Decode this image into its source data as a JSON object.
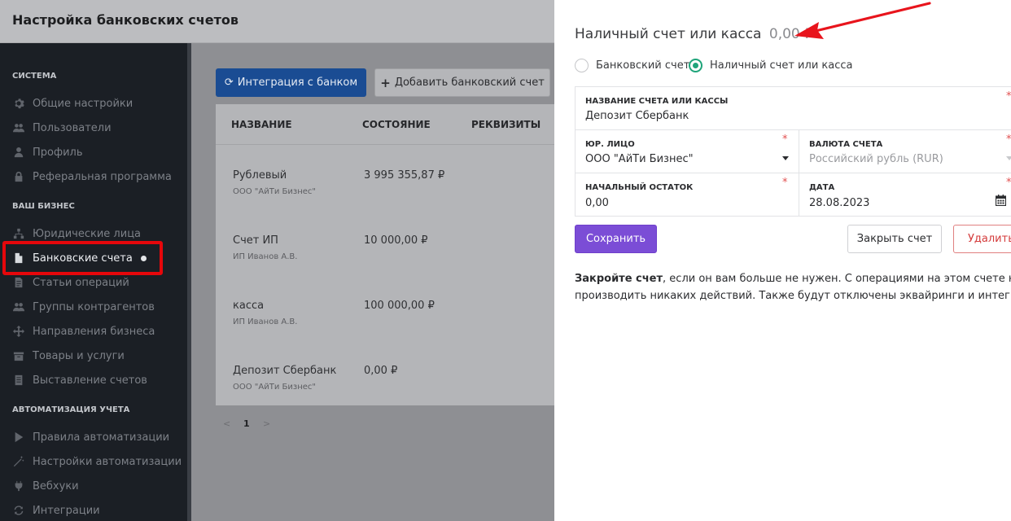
{
  "app": {
    "title": "Настройка банковских счетов"
  },
  "sidebar": {
    "sections": [
      {
        "label": "СИСТЕМА",
        "items": [
          {
            "label": "Общие настройки",
            "icon": "gear-icon"
          },
          {
            "label": "Пользователи",
            "icon": "users-icon"
          },
          {
            "label": "Профиль",
            "icon": "user-icon"
          },
          {
            "label": "Реферальная программа",
            "icon": "lock-icon"
          }
        ]
      },
      {
        "label": "ВАШ БИЗНЕС",
        "items": [
          {
            "label": "Юридические лица",
            "icon": "sitemap-icon"
          },
          {
            "label": "Банковские счета",
            "icon": "file-icon",
            "active": true
          },
          {
            "label": "Статьи операций",
            "icon": "document-icon"
          },
          {
            "label": "Группы контрагентов",
            "icon": "users-icon"
          },
          {
            "label": "Направления бизнеса",
            "icon": "arrows-icon"
          },
          {
            "label": "Товары и услуги",
            "icon": "box-icon"
          },
          {
            "label": "Выставление счетов",
            "icon": "invoice-icon"
          }
        ]
      },
      {
        "label": "АВТОМАТИЗАЦИЯ УЧЕТА",
        "items": [
          {
            "label": "Правила автоматизации",
            "icon": "play-icon"
          },
          {
            "label": "Настройки автоматизации",
            "icon": "magic-wand-icon"
          },
          {
            "label": "Вебхуки",
            "icon": "plug-icon"
          },
          {
            "label": "Интеграции",
            "icon": "refresh-icon"
          }
        ]
      }
    ]
  },
  "toolbar": {
    "integration_label": "Интеграция с банком",
    "integration_icon": "refresh-icon",
    "add_label": "Добавить банковский счет",
    "add_icon": "plus-icon"
  },
  "table": {
    "columns": [
      "НАЗВАНИЕ",
      "СОСТОЯНИЕ",
      "РЕКВИЗИТЫ"
    ],
    "rows": [
      {
        "name": "Рублевый",
        "owner": "ООО \"АйТи Бизнес\"",
        "state": "3 995 355,87 ₽"
      },
      {
        "name": "Счет ИП",
        "owner": "ИП Иванов А.В.",
        "state": "10 000,00 ₽"
      },
      {
        "name": "касса",
        "owner": "ИП Иванов А.В.",
        "state": "100 000,00 ₽"
      },
      {
        "name": "Депозит Сбербанк",
        "owner": "ООО \"АйТи Бизнес\"",
        "state": "0,00 ₽"
      }
    ]
  },
  "pagination": {
    "prev": "<",
    "current": "1",
    "next": ">"
  },
  "panel": {
    "title": "Наличный счет или касса",
    "amount": "0,00 ₽",
    "account_types": [
      {
        "label": "Банковский счет",
        "checked": false
      },
      {
        "label": "Наличный счет или касса",
        "checked": true
      }
    ],
    "fields": {
      "name": {
        "label": "Название счета или кассы",
        "value": "Депозит Сбербанк",
        "required": true
      },
      "legal_entity": {
        "label": "Юр. лицо",
        "value": "ООО \"АйТи Бизнес\"",
        "required": true
      },
      "currency": {
        "label": "Валюта счета",
        "value": "Российский рубль (RUR)",
        "required": true
      },
      "initial_balance": {
        "label": "Начальный остаток",
        "value": "0,00",
        "required": true
      },
      "date": {
        "label": "Дата",
        "value": "28.08.2023",
        "required": true
      }
    },
    "required_mark": "*",
    "save_label": "Сохранить",
    "close_label": "Закрыть счет",
    "delete_label": "Удалить",
    "help_bold": "Закройте счет",
    "help_line1_rest": ", если он вам больше не нужен. С операциями на этом счете нельзя буд",
    "help_line2": "производить никаких действий. Также будут отключены эквайринги и интеграции."
  },
  "colors": {
    "accent_purple": "#7b4dd6",
    "radio_green": "#1fa47a",
    "highlight_red": "#e6070b",
    "delete_red": "#d43b3b",
    "required_red": "#e25050"
  }
}
